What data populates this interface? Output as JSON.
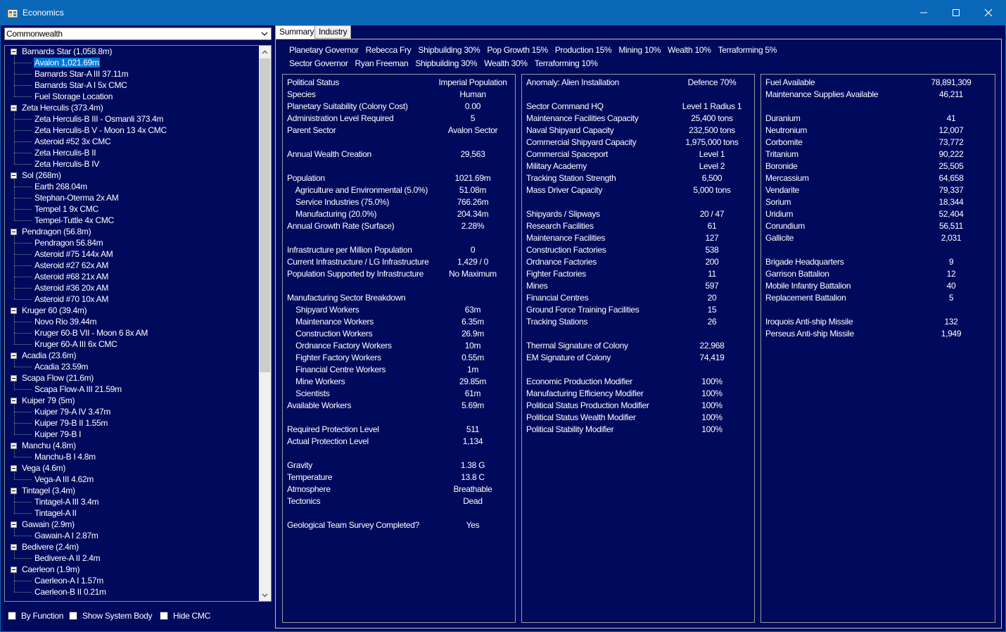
{
  "window": {
    "title": "Economics",
    "minimize": "minimize",
    "maximize": "maximize",
    "close": "close"
  },
  "race_select": {
    "value": "Commonwealth"
  },
  "tree": [
    {
      "label": "Barnards Star  (1,058.8m)",
      "level": 0,
      "expanded": true
    },
    {
      "label": "Avalon  1,021.69m",
      "level": 1,
      "selected": true
    },
    {
      "label": "Barnards Star-A III  37.11m",
      "level": 1
    },
    {
      "label": "Barnards Star-A I  5x CMC",
      "level": 1
    },
    {
      "label": "Fuel Storage Location",
      "level": 1
    },
    {
      "label": "Zeta Herculis  (373.4m)",
      "level": 0,
      "expanded": true
    },
    {
      "label": "Zeta Herculis-B III - Osmanli  373.4m",
      "level": 1
    },
    {
      "label": "Zeta Herculis-B V - Moon 13  4x CMC",
      "level": 1
    },
    {
      "label": "Asteroid #52  3x CMC",
      "level": 1
    },
    {
      "label": "Zeta Herculis-B II",
      "level": 1
    },
    {
      "label": "Zeta Herculis-B IV",
      "level": 1
    },
    {
      "label": "Sol  (268m)",
      "level": 0,
      "expanded": true
    },
    {
      "label": "Earth  268.04m",
      "level": 1
    },
    {
      "label": "Stephan-Oterma  2x AM",
      "level": 1
    },
    {
      "label": "Tempel 1  9x CMC",
      "level": 1
    },
    {
      "label": "Tempel-Tuttle  4x CMC",
      "level": 1
    },
    {
      "label": "Pendragon  (56.8m)",
      "level": 0,
      "expanded": true
    },
    {
      "label": "Pendragon  56.84m",
      "level": 1
    },
    {
      "label": "Asteroid #75  144x AM",
      "level": 1
    },
    {
      "label": "Asteroid #27  62x AM",
      "level": 1
    },
    {
      "label": "Asteroid #68  21x AM",
      "level": 1
    },
    {
      "label": "Asteroid #36  20x AM",
      "level": 1
    },
    {
      "label": "Asteroid #70  10x AM",
      "level": 1
    },
    {
      "label": "Kruger 60  (39.4m)",
      "level": 0,
      "expanded": true
    },
    {
      "label": "Novo Rio  39.44m",
      "level": 1
    },
    {
      "label": "Kruger 60-B VII - Moon 6  8x AM",
      "level": 1
    },
    {
      "label": "Kruger 60-A III  6x CMC",
      "level": 1
    },
    {
      "label": "Acadia  (23.6m)",
      "level": 0,
      "expanded": true
    },
    {
      "label": "Acadia  23.59m",
      "level": 1
    },
    {
      "label": "Scapa Flow  (21.6m)",
      "level": 0,
      "expanded": true
    },
    {
      "label": "Scapa Flow-A III  21.59m",
      "level": 1
    },
    {
      "label": "Kuiper 79  (5m)",
      "level": 0,
      "expanded": true
    },
    {
      "label": "Kuiper 79-A IV  3.47m",
      "level": 1
    },
    {
      "label": "Kuiper 79-B II  1.55m",
      "level": 1
    },
    {
      "label": "Kuiper 79-B I",
      "level": 1
    },
    {
      "label": "Manchu  (4.8m)",
      "level": 0,
      "expanded": true
    },
    {
      "label": "Manchu-B I  4.8m",
      "level": 1
    },
    {
      "label": "Vega  (4.6m)",
      "level": 0,
      "expanded": true
    },
    {
      "label": "Vega-A III  4.62m",
      "level": 1
    },
    {
      "label": "Tintagel  (3.4m)",
      "level": 0,
      "expanded": true
    },
    {
      "label": "Tintagel-A III  3.4m",
      "level": 1
    },
    {
      "label": "Tintagel-A II",
      "level": 1
    },
    {
      "label": "Gawain  (2.9m)",
      "level": 0,
      "expanded": true
    },
    {
      "label": "Gawain-A I  2.87m",
      "level": 1
    },
    {
      "label": "Bedivere  (2.4m)",
      "level": 0,
      "expanded": true
    },
    {
      "label": "Bedivere-A II  2.4m",
      "level": 1
    },
    {
      "label": "Caerleon  (1.9m)",
      "level": 0,
      "expanded": true
    },
    {
      "label": "Caerleon-A I  1.57m",
      "level": 1
    },
    {
      "label": "Caerleon-B II  0.21m",
      "level": 1
    }
  ],
  "checkboxes": {
    "by_function": "By Function",
    "show_system_body": "Show System Body",
    "hide_cmc": "Hide CMC"
  },
  "tabs": {
    "summary": "Summary",
    "industry": "Industry"
  },
  "governors": {
    "planetary": [
      "Planetary Governor",
      "Rebecca Fry",
      "Shipbuilding 30%",
      "Pop Growth 15%",
      "Production 15%",
      "Mining 10%",
      "Wealth 10%",
      "Terraforming 5%"
    ],
    "sector": [
      "Sector Governor",
      "Ryan Freeman",
      "Shipbuilding 30%",
      "Wealth 30%",
      "Terraforming 10%"
    ]
  },
  "panel1": [
    [
      "Political Status",
      "Imperial Population"
    ],
    [
      "Species",
      "Human"
    ],
    [
      "Planetary Suitability (Colony Cost)",
      "0.00"
    ],
    [
      "Administration Level Required",
      "5"
    ],
    [
      "Parent Sector",
      "Avalon Sector"
    ],
    [
      "",
      ""
    ],
    [
      "Annual Wealth Creation",
      "29,563"
    ],
    [
      "",
      ""
    ],
    [
      "Population",
      "1021.69m"
    ],
    [
      "    Agriculture and Environmental (5.0%)",
      "51.08m"
    ],
    [
      "    Service Industries (75.0%)",
      "766.26m"
    ],
    [
      "    Manufacturing (20.0%)",
      "204.34m"
    ],
    [
      "Annual Growth Rate (Surface)",
      "2.28%"
    ],
    [
      "",
      ""
    ],
    [
      "Infrastructure per Million Population",
      "0"
    ],
    [
      "Current Infrastructure / LG Infrastructure",
      "1,429 / 0"
    ],
    [
      "Population Supported by Infrastructure",
      "No Maximum"
    ],
    [
      "",
      ""
    ],
    [
      "Manufacturing Sector Breakdown",
      ""
    ],
    [
      "    Shipyard Workers",
      "63m"
    ],
    [
      "    Maintenance Workers",
      "6.35m"
    ],
    [
      "    Construction Workers",
      "26.9m"
    ],
    [
      "    Ordnance Factory Workers",
      "10m"
    ],
    [
      "    Fighter Factory Workers",
      "0.55m"
    ],
    [
      "    Financial Centre Workers",
      "1m"
    ],
    [
      "    Mine Workers",
      "29.85m"
    ],
    [
      "    Scientists",
      "61m"
    ],
    [
      "Available Workers",
      "5.69m"
    ],
    [
      "",
      ""
    ],
    [
      "Required Protection Level",
      "511"
    ],
    [
      "Actual Protection Level",
      "1,134"
    ],
    [
      "",
      ""
    ],
    [
      "Gravity",
      "1.38 G"
    ],
    [
      "Temperature",
      "13.8 C"
    ],
    [
      "Atmosphere",
      "Breathable"
    ],
    [
      "Tectonics",
      "Dead"
    ],
    [
      "",
      ""
    ],
    [
      "Geological Team Survey Completed?",
      "Yes"
    ]
  ],
  "panel2": [
    [
      "Anomaly: Alien Installation",
      "Defence 70%"
    ],
    [
      "",
      ""
    ],
    [
      "Sector Command HQ",
      "Level 1  Radius 1"
    ],
    [
      "Maintenance Facilities Capacity",
      "25,400 tons"
    ],
    [
      "Naval Shipyard Capacity",
      "232,500 tons"
    ],
    [
      "Commercial Shipyard Capacity",
      "1,975,000 tons"
    ],
    [
      "Commercial Spaceport",
      "Level 1"
    ],
    [
      "Military Academy",
      "Level 2"
    ],
    [
      "Tracking Station Strength",
      "6,500"
    ],
    [
      "Mass Driver Capacity",
      "5,000 tons"
    ],
    [
      "",
      ""
    ],
    [
      "Shipyards / Slipways",
      "20 / 47"
    ],
    [
      "Research Facilities",
      "61"
    ],
    [
      "Maintenance Facilities",
      "127"
    ],
    [
      "Construction Factories",
      "538"
    ],
    [
      "Ordnance Factories",
      "200"
    ],
    [
      "Fighter Factories",
      "11"
    ],
    [
      "Mines",
      "597"
    ],
    [
      "Financial Centres",
      "20"
    ],
    [
      "Ground Force Training Facilities",
      "15"
    ],
    [
      "Tracking Stations",
      "26"
    ],
    [
      "",
      ""
    ],
    [
      "Thermal Signature of Colony",
      "22,968"
    ],
    [
      "EM Signature of Colony",
      "74,419"
    ],
    [
      "",
      ""
    ],
    [
      "Economic Production Modifier",
      "100%"
    ],
    [
      "Manufacturing Efficiency Modifier",
      "100%"
    ],
    [
      "Political Status Production Modifier",
      "100%"
    ],
    [
      "Political Status Wealth Modifier",
      "100%"
    ],
    [
      "Political Stability Modifier",
      "100%"
    ]
  ],
  "panel3": [
    [
      "Fuel Available",
      "78,891,309"
    ],
    [
      "Maintenance Supplies Available",
      "46,211"
    ],
    [
      "",
      ""
    ],
    [
      "Duranium",
      "41"
    ],
    [
      "Neutronium",
      "12,007"
    ],
    [
      "Corbomite",
      "73,772"
    ],
    [
      "Tritanium",
      "90,222"
    ],
    [
      "Boronide",
      "25,505"
    ],
    [
      "Mercassium",
      "64,658"
    ],
    [
      "Vendarite",
      "79,337"
    ],
    [
      "Sorium",
      "18,344"
    ],
    [
      "Uridium",
      "52,404"
    ],
    [
      "Corundium",
      "56,511"
    ],
    [
      "Gallicite",
      "2,031"
    ],
    [
      "",
      ""
    ],
    [
      "Brigade Headquarters",
      "9"
    ],
    [
      "Garrison Battalion",
      "12"
    ],
    [
      "Mobile Infantry Battalion",
      "40"
    ],
    [
      "Replacement Battalion",
      "5"
    ],
    [
      "",
      ""
    ],
    [
      "Iroquois Anti-ship Missile",
      "132"
    ],
    [
      "Perseus Anti-ship Missile",
      "1,949"
    ]
  ],
  "colors": {
    "background": "#000a5c",
    "titlebar": "#0a67b8",
    "selection": "#0078d7"
  }
}
